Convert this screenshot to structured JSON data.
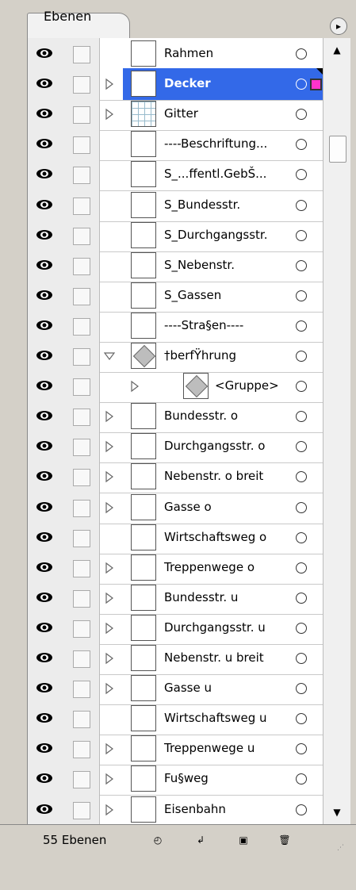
{
  "panel": {
    "tab_label": "Ebenen",
    "menu_icon": "panel-menu-icon",
    "footer": {
      "count_label": "55 Ebenen",
      "icons": [
        "make-clipping-mask-icon",
        "create-sublayer-icon",
        "create-new-layer-icon",
        "delete-layer-icon"
      ]
    },
    "colors": {
      "selected_row": "#3369e8",
      "selected_square": "#ff33cc",
      "panel_bg": "#d4d0c8"
    }
  },
  "layers": [
    {
      "label": "Rahmen",
      "arrow": "none",
      "thumb": "blank"
    },
    {
      "label": "Decker",
      "arrow": "right",
      "thumb": "blank",
      "selected": true
    },
    {
      "label": "Gitter",
      "arrow": "right",
      "thumb": "grid"
    },
    {
      "label": "----Beschriftung...",
      "arrow": "none",
      "thumb": "blank"
    },
    {
      "label": "S_...ffentl.GebŠ...",
      "arrow": "none",
      "thumb": "blank"
    },
    {
      "label": "S_Bundesstr.",
      "arrow": "none",
      "thumb": "blank"
    },
    {
      "label": "S_Durchgangsstr.",
      "arrow": "none",
      "thumb": "blank"
    },
    {
      "label": "S_Nebenstr.",
      "arrow": "none",
      "thumb": "blank"
    },
    {
      "label": "S_Gassen",
      "arrow": "none",
      "thumb": "blank"
    },
    {
      "label": "----Stra§en----",
      "arrow": "none",
      "thumb": "blank"
    },
    {
      "label": "†berfŸhrung",
      "arrow": "down",
      "thumb": "diamond"
    },
    {
      "label": "<Gruppe>",
      "arrow": "right",
      "thumb": "diamond",
      "sub": true
    },
    {
      "label": "Bundesstr. o",
      "arrow": "right",
      "thumb": "blank"
    },
    {
      "label": "Durchgangsstr. o",
      "arrow": "right",
      "thumb": "blank"
    },
    {
      "label": "Nebenstr. o breit",
      "arrow": "right",
      "thumb": "blank"
    },
    {
      "label": "Gasse o",
      "arrow": "right",
      "thumb": "blank"
    },
    {
      "label": "Wirtschaftsweg o",
      "arrow": "none",
      "thumb": "blank"
    },
    {
      "label": "Treppenwege o",
      "arrow": "right",
      "thumb": "blank"
    },
    {
      "label": "Bundesstr. u",
      "arrow": "right",
      "thumb": "blank"
    },
    {
      "label": "Durchgangsstr. u",
      "arrow": "right",
      "thumb": "blank"
    },
    {
      "label": "Nebenstr. u breit",
      "arrow": "right",
      "thumb": "blank"
    },
    {
      "label": "Gasse u",
      "arrow": "right",
      "thumb": "blank"
    },
    {
      "label": "Wirtschaftsweg u",
      "arrow": "none",
      "thumb": "blank"
    },
    {
      "label": "Treppenwege u",
      "arrow": "right",
      "thumb": "blank"
    },
    {
      "label": "Fu§weg",
      "arrow": "right",
      "thumb": "blank"
    },
    {
      "label": "Eisenbahn",
      "arrow": "right",
      "thumb": "blank"
    }
  ]
}
